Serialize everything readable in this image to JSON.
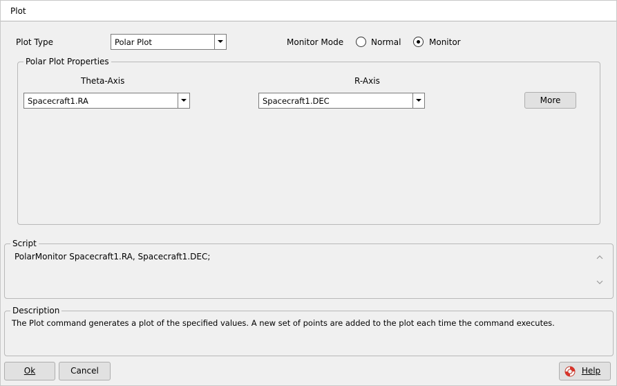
{
  "window": {
    "title": "Plot"
  },
  "plot_type": {
    "label": "Plot Type",
    "value": "Polar Plot"
  },
  "monitor_mode": {
    "label": "Monitor Mode",
    "options": [
      "Normal",
      "Monitor"
    ],
    "selected": "Monitor"
  },
  "properties": {
    "legend": "Polar Plot Properties",
    "theta_axis": {
      "label": "Theta-Axis",
      "value": "Spacecraft1.RA"
    },
    "r_axis": {
      "label": "R-Axis",
      "value": "Spacecraft1.DEC"
    },
    "more_label": "More"
  },
  "script": {
    "legend": "Script",
    "text": "PolarMonitor Spacecraft1.RA, Spacecraft1.DEC;"
  },
  "description": {
    "legend": "Description",
    "text": "The Plot command generates a plot of the specified values. A new set of points are added to the plot each time the command executes."
  },
  "buttons": {
    "ok": "Ok",
    "cancel": "Cancel",
    "help": "Help"
  }
}
